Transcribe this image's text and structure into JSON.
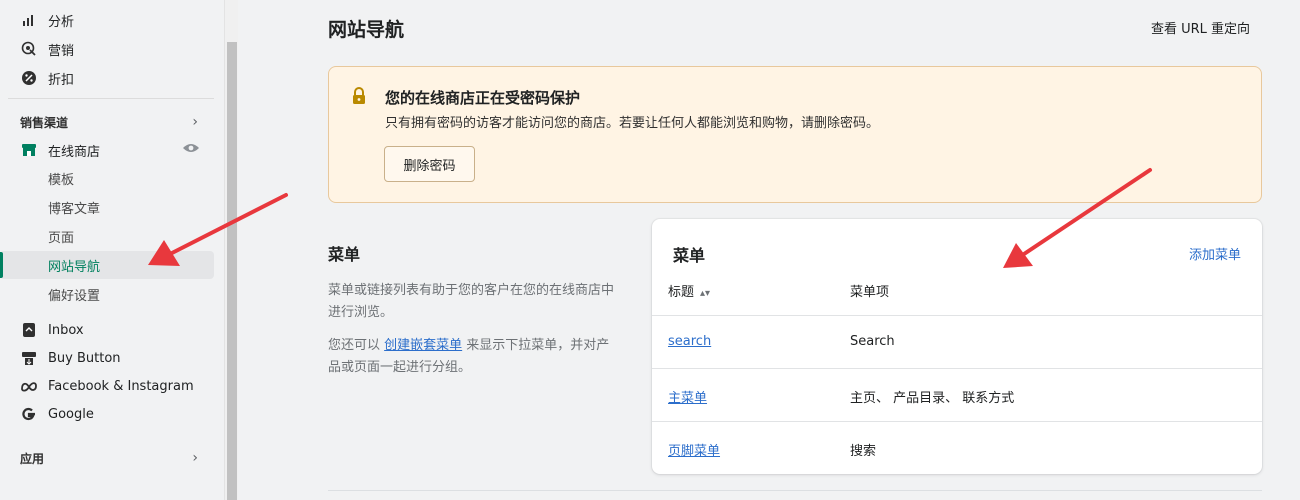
{
  "sidebar": {
    "top_items": [
      {
        "label": "分析",
        "icon": "bar-chart-icon"
      },
      {
        "label": "营销",
        "icon": "target-icon"
      },
      {
        "label": "折扣",
        "icon": "discount-icon"
      }
    ],
    "sales_channels_label": "销售渠道",
    "online_store_label": "在线商店",
    "sub_items": [
      "模板",
      "博客文章",
      "页面",
      "网站导航",
      "偏好设置"
    ],
    "channel_items": [
      {
        "label": "Inbox",
        "icon": "inbox-icon"
      },
      {
        "label": "Buy Button",
        "icon": "buy-button-icon"
      },
      {
        "label": "Facebook & Instagram",
        "icon": "meta-icon"
      },
      {
        "label": "Google",
        "icon": "google-icon"
      }
    ],
    "apps_label": "应用"
  },
  "header": {
    "title": "网站导航",
    "redirect_link": "查看 URL 重定向"
  },
  "banner": {
    "title": "您的在线商店正在受密码保护",
    "description": "只有拥有密码的访客才能访问您的商店。若要让任何人都能浏览和购物，请删除密码。",
    "button": "删除密码"
  },
  "menu_section": {
    "title": "菜单",
    "description": "菜单或链接列表有助于您的客户在您的在线商店中进行浏览。",
    "desc2_prefix": "您还可以 ",
    "desc2_link": "创建嵌套菜单",
    "desc2_suffix": " 来显示下拉菜单，并对产品或页面一起进行分组。"
  },
  "menu_card": {
    "title": "菜单",
    "add_link": "添加菜单",
    "col_title": "标题",
    "col_items": "菜单项",
    "rows": [
      {
        "title": "search",
        "items": "Search"
      },
      {
        "title": "主菜单",
        "items": "主页、 产品目录、 联系方式"
      },
      {
        "title": "页脚菜单",
        "items": "搜索"
      }
    ]
  },
  "colors": {
    "accent_green": "#008060",
    "link_blue": "#2c6ecb",
    "banner_bg": "#fff4e4",
    "arrow_red": "#e8383d"
  }
}
